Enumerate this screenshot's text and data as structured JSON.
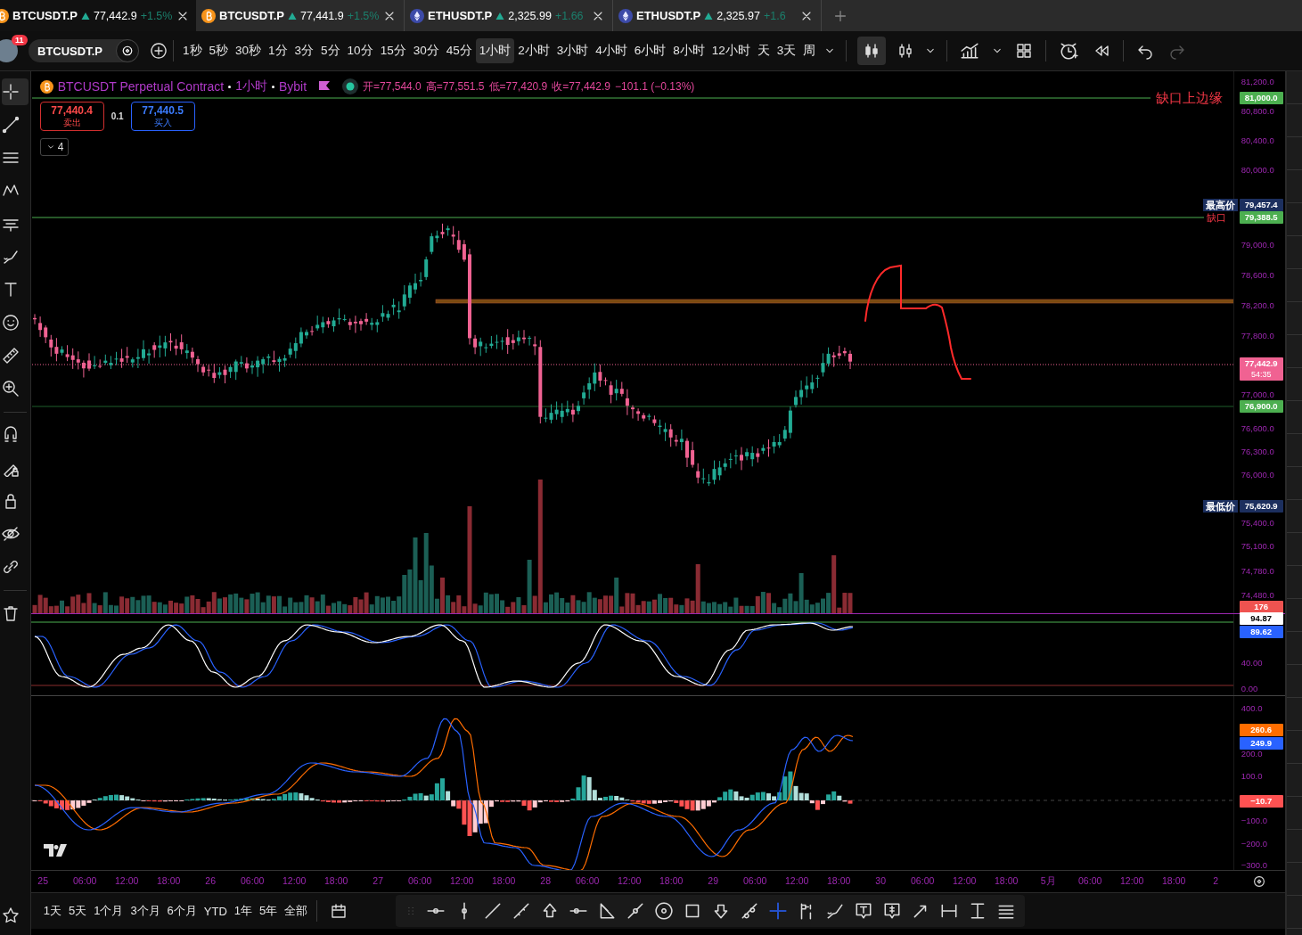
{
  "tabs": [
    {
      "kind": "btc",
      "symbol": "BTCUSDT.P",
      "price": "77,442.9",
      "change": "+1.5%",
      "selected": true
    },
    {
      "kind": "btc",
      "symbol": "BTCUSDT.P",
      "price": "77,441.9",
      "change": "+1.5%",
      "selected": false
    },
    {
      "kind": "eth",
      "symbol": "ETHUSDT.P",
      "price": "2,325.99",
      "change": "+1.66",
      "selected": false
    },
    {
      "kind": "eth",
      "symbol": "ETHUSDT.P",
      "price": "2,325.97",
      "change": "+1.6",
      "selected": false
    }
  ],
  "account": {
    "badge": "11"
  },
  "symbol_field": {
    "value": "BTCUSDT.P"
  },
  "intervals": [
    {
      "label": "1秒",
      "selected": false
    },
    {
      "label": "5秒",
      "selected": false
    },
    {
      "label": "30秒",
      "selected": false
    },
    {
      "label": "1分",
      "selected": false
    },
    {
      "label": "3分",
      "selected": false
    },
    {
      "label": "5分",
      "selected": false
    },
    {
      "label": "10分",
      "selected": false
    },
    {
      "label": "15分",
      "selected": false
    },
    {
      "label": "30分",
      "selected": false
    },
    {
      "label": "45分",
      "selected": false
    },
    {
      "label": "1小时",
      "selected": true
    },
    {
      "label": "2小时",
      "selected": false
    },
    {
      "label": "3小时",
      "selected": false
    },
    {
      "label": "4小时",
      "selected": false
    },
    {
      "label": "6小时",
      "selected": false
    },
    {
      "label": "8小时",
      "selected": false
    },
    {
      "label": "12小时",
      "selected": false
    },
    {
      "label": "天",
      "selected": false
    },
    {
      "label": "3天",
      "selected": false
    },
    {
      "label": "周",
      "selected": false
    }
  ],
  "chart_types": [
    {
      "kind": "candles",
      "selected": true
    },
    {
      "kind": "hollow",
      "selected": false
    }
  ],
  "redo": {
    "disabled": true
  },
  "left_tools": [
    {
      "kind": "crosshair",
      "selected": true
    },
    {
      "kind": "trendline",
      "selected": false
    },
    {
      "kind": "fib",
      "selected": false
    },
    {
      "kind": "pattern",
      "selected": false
    },
    {
      "kind": "forecast",
      "selected": false
    },
    {
      "kind": "brush",
      "selected": false
    },
    {
      "kind": "text",
      "selected": false
    },
    {
      "kind": "emoji",
      "selected": false
    },
    {
      "kind": "ruler",
      "selected": false
    },
    {
      "kind": "zoom",
      "selected": false
    },
    {
      "kind": "magnet",
      "selected": false
    },
    {
      "kind": "lockpen",
      "selected": false
    },
    {
      "kind": "lock",
      "selected": false
    },
    {
      "kind": "eye",
      "selected": false
    },
    {
      "kind": "link",
      "selected": false
    },
    {
      "kind": "trash",
      "selected": false
    }
  ],
  "legend": {
    "title": "BTCUSDT Perpetual Contract",
    "interval": "1小时",
    "exchange": "Bybit",
    "values": [
      "开=77,544.0",
      "高=77,551.5",
      "低=77,420.9",
      "收=77,442.9",
      "−101.1 (−0.13%)"
    ]
  },
  "order": {
    "sell_price": "77,440.4",
    "sell_label": "卖出",
    "quantity": "0.1",
    "buy_price": "77,440.5",
    "buy_label": "买入"
  },
  "indicators_toggle": {
    "count": "4"
  },
  "line_labels": [
    {
      "text": "缺口上边缘"
    },
    {
      "text": "缺口"
    }
  ],
  "price_axis": {
    "labels": [
      "81,200.0",
      "80,800.0",
      "80,400.0",
      "80,000.0",
      "79,000.0",
      "78,600.0",
      "78,200.0",
      "77,800.0",
      "77,000.0",
      "76,600.0",
      "76,300.0",
      "76,000.0",
      "75,400.0",
      "75,100.0",
      "74,780.0",
      "74,480.0"
    ],
    "tags": [
      {
        "value": "81,000.0",
        "color": "#4caf50"
      },
      {
        "caption": "最高价",
        "value": "79,457.4",
        "color": "#1c2f5e"
      },
      {
        "value": "79,388.5",
        "color": "#4caf50"
      },
      {
        "value": "77,442.9",
        "sub": "54:35",
        "color": "#f06292"
      },
      {
        "value": "76,900.0",
        "color": "#4caf50"
      },
      {
        "caption": "最低价",
        "value": "75,620.9",
        "color": "#1c2f5e"
      },
      {
        "value": "176",
        "color": "#ef5350"
      }
    ]
  },
  "stoch_axis": {
    "labels": [
      "40.00",
      "0.00"
    ],
    "tags": [
      {
        "value": "94.87",
        "color": "#ffffff"
      },
      {
        "value": "89.62",
        "color": "#2962ff"
      }
    ]
  },
  "macd_axis": {
    "labels": [
      "400.0",
      "200.0",
      "100.0",
      "−100.0",
      "−200.0",
      "−300.0"
    ],
    "tags": [
      {
        "value": "260.6",
        "color": "#ff6d00"
      },
      {
        "value": "249.9",
        "color": "#2962ff"
      },
      {
        "value": "−10.7",
        "color": "#ff5252"
      }
    ]
  },
  "time_axis": {
    "labels": [
      "25",
      "06:00",
      "12:00",
      "18:00",
      "26",
      "06:00",
      "12:00",
      "18:00",
      "27",
      "06:00",
      "12:00",
      "18:00",
      "28",
      "06:00",
      "12:00",
      "18:00",
      "29",
      "06:00",
      "12:00",
      "18:00",
      "30",
      "06:00",
      "12:00",
      "18:00",
      "5月",
      "06:00",
      "12:00",
      "18:00",
      "2"
    ]
  },
  "ranges": [
    "1天",
    "5天",
    "1个月",
    "3个月",
    "6个月",
    "YTD",
    "1年",
    "5年",
    "全部"
  ],
  "draw_tools": [
    {
      "kind": "hline",
      "selected": false
    },
    {
      "kind": "vline",
      "selected": false
    },
    {
      "kind": "line",
      "selected": false
    },
    {
      "kind": "ray",
      "selected": false
    },
    {
      "kind": "uparrow",
      "selected": false
    },
    {
      "kind": "hray",
      "selected": false
    },
    {
      "kind": "triangle",
      "selected": false
    },
    {
      "kind": "path",
      "selected": false
    },
    {
      "kind": "circle",
      "selected": false
    },
    {
      "kind": "rect",
      "selected": false
    },
    {
      "kind": "downarrow",
      "selected": false
    },
    {
      "kind": "segment",
      "selected": false
    },
    {
      "kind": "cross",
      "selected": true
    },
    {
      "kind": "flag",
      "selected": false
    },
    {
      "kind": "brush",
      "selected": false
    },
    {
      "kind": "note",
      "selected": false
    },
    {
      "kind": "pricenote",
      "selected": false
    },
    {
      "kind": "arrow",
      "selected": false
    },
    {
      "kind": "hrange",
      "selected": false
    },
    {
      "kind": "vrange",
      "selected": false
    },
    {
      "kind": "lines",
      "selected": false
    }
  ]
}
